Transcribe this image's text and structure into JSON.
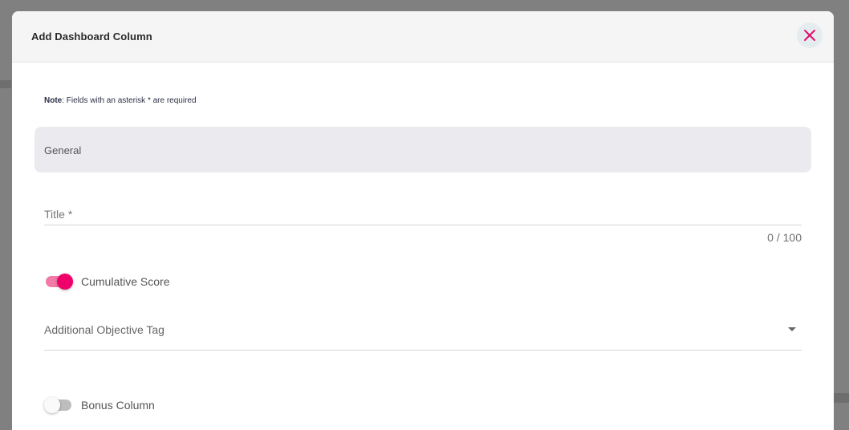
{
  "dialog": {
    "title": "Add Dashboard Column",
    "close_icon": "close-icon"
  },
  "note": {
    "label": "Note",
    "text": ": Fields with an asterisk * are required"
  },
  "section": {
    "label": "General"
  },
  "title_field": {
    "placeholder": "Title *",
    "value": "",
    "counter": "0 / 100"
  },
  "cumulative_score": {
    "label": "Cumulative Score",
    "checked": true
  },
  "objective_tag": {
    "placeholder": "Additional Objective Tag",
    "icon": "chevron-down-icon"
  },
  "bonus_column": {
    "label": "Bonus Column",
    "checked": false
  },
  "colors": {
    "accent": "#f0006a",
    "accent_light": "#f27aa6",
    "header_bg": "#f5f5f5",
    "section_bg": "#ebebef"
  }
}
